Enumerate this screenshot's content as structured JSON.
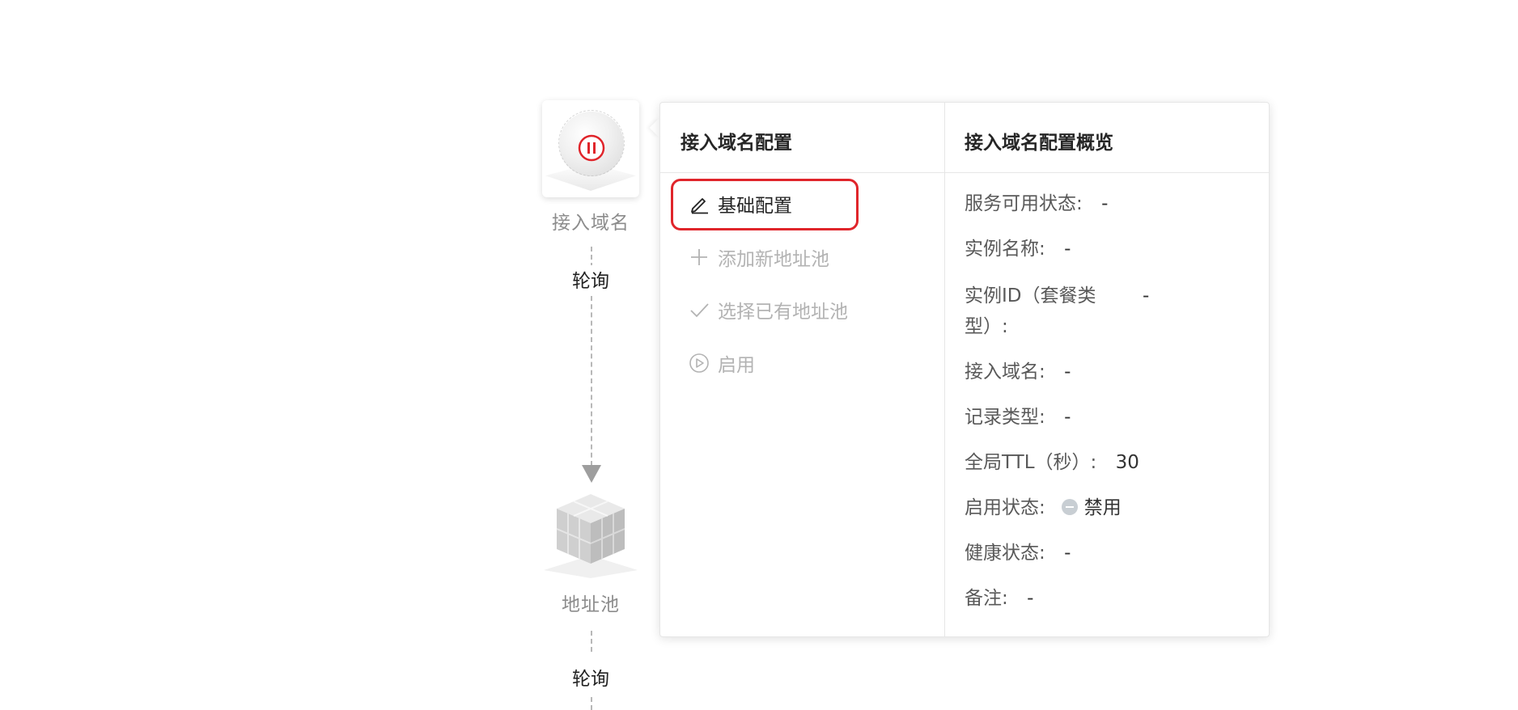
{
  "flow": {
    "node1_label": "接入域名",
    "edge1_label": "轮询",
    "node2_label": "地址池",
    "edge2_label": "轮询"
  },
  "panel": {
    "left_title": "接入域名配置",
    "right_title": "接入域名配置概览",
    "menu": [
      {
        "label": "基础配置",
        "icon": "edit-icon",
        "enabled": true
      },
      {
        "label": "添加新地址池",
        "icon": "plus-icon",
        "enabled": false
      },
      {
        "label": "选择已有地址池",
        "icon": "check-icon",
        "enabled": false
      },
      {
        "label": "启用",
        "icon": "play-circle-icon",
        "enabled": false
      }
    ],
    "overview": {
      "service_status_label": "服务可用状态:",
      "service_status_value": "-",
      "instance_name_label": "实例名称:",
      "instance_name_value": "-",
      "instance_id_label": "实例ID（套餐类型）:",
      "instance_id_value": "-",
      "domain_label": "接入域名:",
      "domain_value": "-",
      "record_type_label": "记录类型:",
      "record_type_value": "-",
      "ttl_label": "全局TTL（秒）:",
      "ttl_value": "30",
      "enable_status_label": "启用状态:",
      "enable_status_value": "禁用",
      "health_label": "健康状态:",
      "health_value": "-",
      "remark_label": "备注:",
      "remark_value": "-"
    }
  },
  "colors": {
    "highlight": "#e0252b",
    "pause_icon": "#e0252b",
    "disabled_text": "#b3b3b3"
  }
}
